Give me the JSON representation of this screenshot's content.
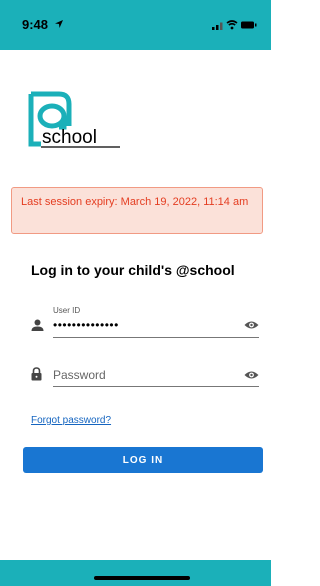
{
  "status_bar": {
    "time": "9:48",
    "icons": [
      "location-arrow-icon",
      "signal-icon",
      "wifi-icon",
      "battery-icon"
    ],
    "color": "#1bb0b9"
  },
  "brand": {
    "logo_text": "school",
    "accent": "#1bb0b9"
  },
  "alert": {
    "message": "Last session expiry: March 19, 2022, 11:14 am",
    "bg": "#fbe1d9",
    "border": "#f19a83",
    "text_color": "#e43d21"
  },
  "login": {
    "heading": "Log in to your child's @school",
    "user_id": {
      "label": "User ID",
      "value": "••••••••••••••"
    },
    "password": {
      "placeholder": "Password",
      "value": ""
    },
    "forgot_link": "Forgot password?",
    "submit_label": "LOG IN",
    "button_color": "#1976d2"
  }
}
